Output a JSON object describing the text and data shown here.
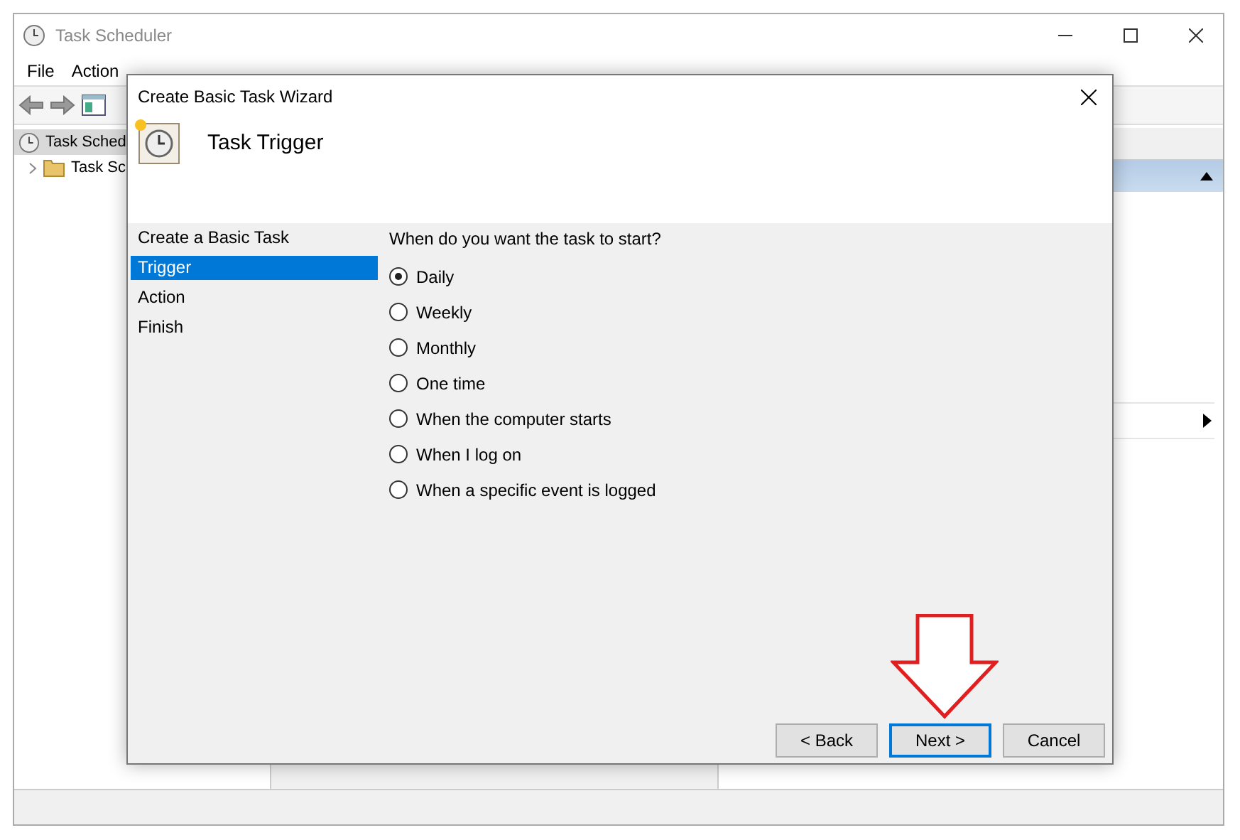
{
  "window": {
    "title": "Task Scheduler"
  },
  "menu": [
    "File",
    "Action"
  ],
  "tree": [
    {
      "label": "Task Sched",
      "selected": true,
      "children": [
        {
          "label": "Task Sc",
          "selected": false
        }
      ]
    }
  ],
  "wizard": {
    "title": "Create Basic Task Wizard",
    "heading": "Task Trigger",
    "steps": [
      {
        "label": "Create a Basic Task",
        "selected": false
      },
      {
        "label": "Trigger",
        "selected": true
      },
      {
        "label": "Action",
        "selected": false
      },
      {
        "label": "Finish",
        "selected": false
      }
    ],
    "question": "When do you want the task to start?",
    "options": [
      {
        "label": "Daily",
        "selected": true
      },
      {
        "label": "Weekly",
        "selected": false
      },
      {
        "label": "Monthly",
        "selected": false
      },
      {
        "label": "One time",
        "selected": false
      },
      {
        "label": "When the computer starts",
        "selected": false
      },
      {
        "label": "When I log on",
        "selected": false
      },
      {
        "label": "When a specific event is logged",
        "selected": false
      }
    ],
    "buttons": [
      {
        "label": "< Back",
        "default": false
      },
      {
        "label": "Next >",
        "default": true
      },
      {
        "label": "Cancel",
        "default": false
      }
    ]
  }
}
